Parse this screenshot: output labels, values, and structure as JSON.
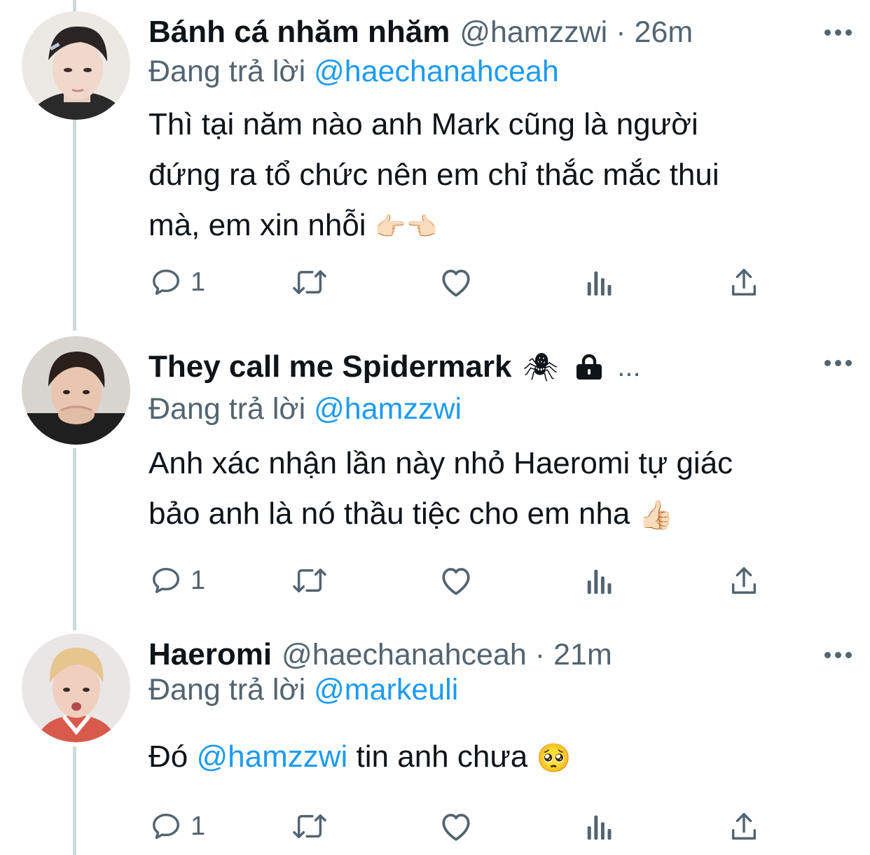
{
  "tweets": [
    {
      "name": "Bánh cá nhăm nhăm",
      "handle": "@hamzzwi",
      "separator": "·",
      "time": "26m",
      "replying_prefix": "Đang trả lời",
      "replying_to": "@haechanahceah",
      "body_lines": [
        "Thì tại năm nào anh Mark cũng là người",
        "đứng ra tổ chức nên em chỉ thắc mắc thui",
        "mà, em xin nhỗi"
      ],
      "body_emoji": "👉🏻👈🏻",
      "reply_count": "1"
    },
    {
      "name": "They call me Spidermark",
      "name_emoji": "🕷",
      "name_overflow": "...",
      "replying_prefix": "Đang trả lời",
      "replying_to": "@hamzzwi",
      "body_lines": [
        "Anh xác nhận lần này nhỏ Haeromi tự giác",
        "bảo anh là nó thầu tiệc cho em nha"
      ],
      "body_emoji": "👍🏻",
      "reply_count": "1"
    },
    {
      "name": "Haeromi",
      "handle": "@haechanahceah",
      "separator": "·",
      "time": "21m",
      "replying_prefix": "Đang trả lời",
      "replying_to": "@markeuli",
      "body_start": "Đó",
      "body_mention": "@hamzzwi",
      "body_end": "tin anh chưa",
      "body_emoji": "🥺",
      "reply_count": "1"
    }
  ],
  "icons": {
    "reply": "reply-icon",
    "retweet": "retweet-icon",
    "like": "heart-icon",
    "views": "views-icon",
    "share": "share-icon",
    "more": "more-icon",
    "lock": "lock-icon"
  },
  "colors": {
    "text": "#0f1419",
    "secondary": "#536471",
    "link": "#1d9bf0",
    "thread_line": "#cfd9de"
  }
}
